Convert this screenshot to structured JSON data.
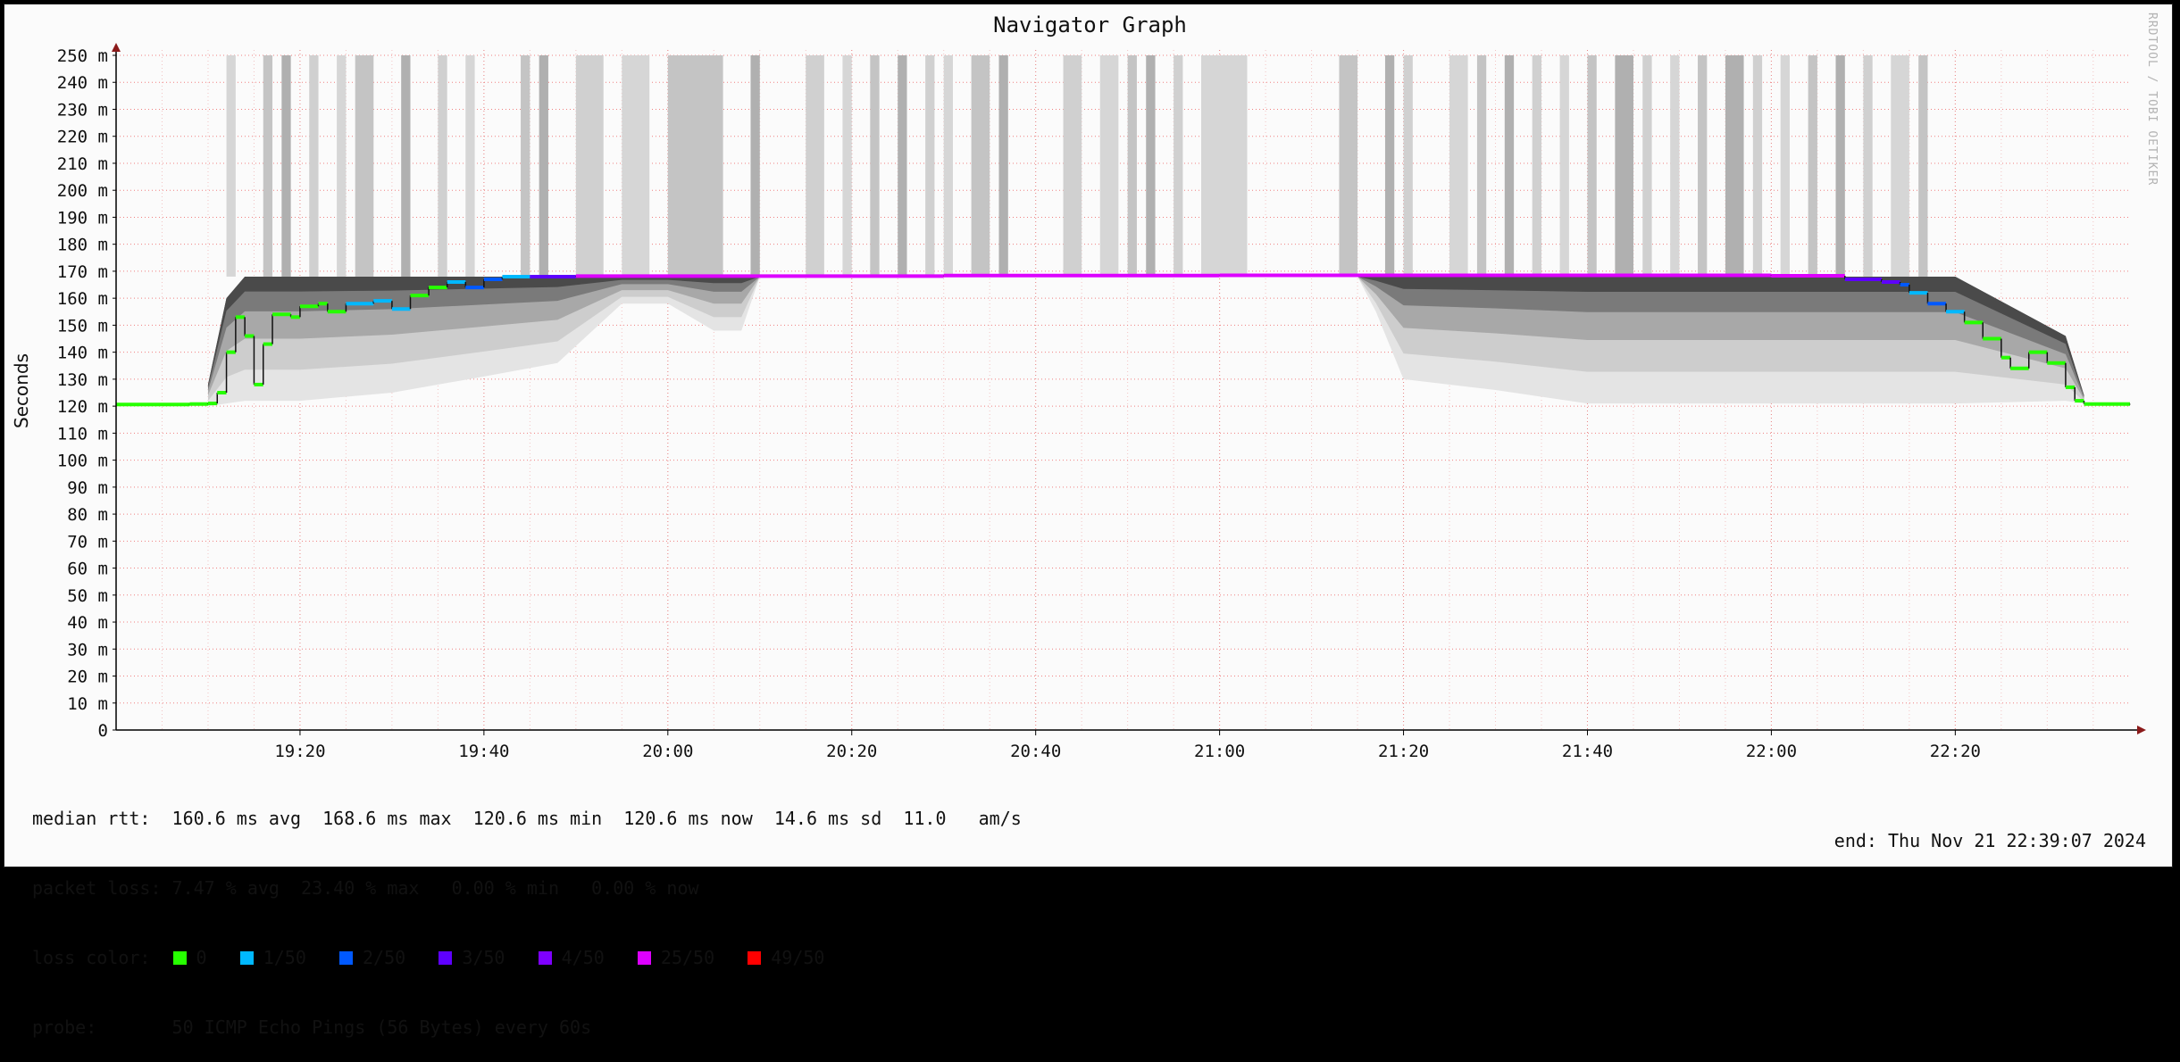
{
  "chart_data": {
    "type": "line",
    "title": "Navigator Graph",
    "ylabel": "Seconds",
    "credit": "RRDTOOL / TOBI OETIKER",
    "ylim": [
      0,
      0.25
    ],
    "y_ticks": [
      {
        "v": 0,
        "label": "0"
      },
      {
        "v": 0.01,
        "label": "10 m"
      },
      {
        "v": 0.02,
        "label": "20 m"
      },
      {
        "v": 0.03,
        "label": "30 m"
      },
      {
        "v": 0.04,
        "label": "40 m"
      },
      {
        "v": 0.05,
        "label": "50 m"
      },
      {
        "v": 0.06,
        "label": "60 m"
      },
      {
        "v": 0.07,
        "label": "70 m"
      },
      {
        "v": 0.08,
        "label": "80 m"
      },
      {
        "v": 0.09,
        "label": "90 m"
      },
      {
        "v": 0.1,
        "label": "100 m"
      },
      {
        "v": 0.11,
        "label": "110 m"
      },
      {
        "v": 0.12,
        "label": "120 m"
      },
      {
        "v": 0.13,
        "label": "130 m"
      },
      {
        "v": 0.14,
        "label": "140 m"
      },
      {
        "v": 0.15,
        "label": "150 m"
      },
      {
        "v": 0.16,
        "label": "160 m"
      },
      {
        "v": 0.17,
        "label": "170 m"
      },
      {
        "v": 0.18,
        "label": "180 m"
      },
      {
        "v": 0.19,
        "label": "190 m"
      },
      {
        "v": 0.2,
        "label": "200 m"
      },
      {
        "v": 0.21,
        "label": "210 m"
      },
      {
        "v": 0.22,
        "label": "220 m"
      },
      {
        "v": 0.23,
        "label": "230 m"
      },
      {
        "v": 0.24,
        "label": "240 m"
      },
      {
        "v": 0.25,
        "label": "250 m"
      }
    ],
    "xlim": [
      "19:00",
      "22:39"
    ],
    "x_ticks": [
      "19:20",
      "19:40",
      "20:00",
      "20:20",
      "20:40",
      "21:00",
      "21:20",
      "21:40",
      "22:00",
      "22:20"
    ],
    "grid": true,
    "median_rtt_series": [
      {
        "t": "19:00",
        "rtt_ms": 120.6,
        "loss": "0"
      },
      {
        "t": "19:08",
        "rtt_ms": 120.8,
        "loss": "0"
      },
      {
        "t": "19:10",
        "rtt_ms": 121.0,
        "loss": "0"
      },
      {
        "t": "19:11",
        "rtt_ms": 125.0,
        "loss": "0"
      },
      {
        "t": "19:12",
        "rtt_ms": 140.0,
        "loss": "0"
      },
      {
        "t": "19:13",
        "rtt_ms": 153.0,
        "loss": "0"
      },
      {
        "t": "19:14",
        "rtt_ms": 146.0,
        "loss": "0"
      },
      {
        "t": "19:15",
        "rtt_ms": 128.0,
        "loss": "0"
      },
      {
        "t": "19:16",
        "rtt_ms": 143.0,
        "loss": "0"
      },
      {
        "t": "19:17",
        "rtt_ms": 154.0,
        "loss": "0"
      },
      {
        "t": "19:19",
        "rtt_ms": 153.0,
        "loss": "0"
      },
      {
        "t": "19:20",
        "rtt_ms": 157.0,
        "loss": "0"
      },
      {
        "t": "19:22",
        "rtt_ms": 158.0,
        "loss": "0"
      },
      {
        "t": "19:23",
        "rtt_ms": 155.0,
        "loss": "0"
      },
      {
        "t": "19:25",
        "rtt_ms": 158.0,
        "loss": "1/50"
      },
      {
        "t": "19:28",
        "rtt_ms": 159.0,
        "loss": "1/50"
      },
      {
        "t": "19:30",
        "rtt_ms": 156.0,
        "loss": "1/50"
      },
      {
        "t": "19:32",
        "rtt_ms": 161.0,
        "loss": "0"
      },
      {
        "t": "19:34",
        "rtt_ms": 164.0,
        "loss": "0"
      },
      {
        "t": "19:36",
        "rtt_ms": 166.0,
        "loss": "1/50"
      },
      {
        "t": "19:38",
        "rtt_ms": 164.0,
        "loss": "2/50"
      },
      {
        "t": "19:40",
        "rtt_ms": 167.0,
        "loss": "2/50"
      },
      {
        "t": "19:42",
        "rtt_ms": 168.0,
        "loss": "1/50"
      },
      {
        "t": "19:45",
        "rtt_ms": 168.0,
        "loss": "3/50"
      },
      {
        "t": "19:50",
        "rtt_ms": 168.2,
        "loss": "25/50"
      },
      {
        "t": "20:30",
        "rtt_ms": 168.4,
        "loss": "25/50"
      },
      {
        "t": "21:00",
        "rtt_ms": 168.5,
        "loss": "25/50"
      },
      {
        "t": "21:30",
        "rtt_ms": 168.5,
        "loss": "25/50"
      },
      {
        "t": "22:00",
        "rtt_ms": 168.3,
        "loss": "25/50"
      },
      {
        "t": "22:08",
        "rtt_ms": 167.0,
        "loss": "3/50"
      },
      {
        "t": "22:12",
        "rtt_ms": 166.0,
        "loss": "3/50"
      },
      {
        "t": "22:14",
        "rtt_ms": 165.0,
        "loss": "2/50"
      },
      {
        "t": "22:15",
        "rtt_ms": 162.0,
        "loss": "1/50"
      },
      {
        "t": "22:17",
        "rtt_ms": 158.0,
        "loss": "2/50"
      },
      {
        "t": "22:19",
        "rtt_ms": 155.0,
        "loss": "1/50"
      },
      {
        "t": "22:21",
        "rtt_ms": 151.0,
        "loss": "0"
      },
      {
        "t": "22:23",
        "rtt_ms": 145.0,
        "loss": "0"
      },
      {
        "t": "22:25",
        "rtt_ms": 138.0,
        "loss": "0"
      },
      {
        "t": "22:26",
        "rtt_ms": 134.0,
        "loss": "0"
      },
      {
        "t": "22:28",
        "rtt_ms": 140.0,
        "loss": "0"
      },
      {
        "t": "22:30",
        "rtt_ms": 136.0,
        "loss": "0"
      },
      {
        "t": "22:32",
        "rtt_ms": 127.0,
        "loss": "0"
      },
      {
        "t": "22:33",
        "rtt_ms": 122.0,
        "loss": "0"
      },
      {
        "t": "22:34",
        "rtt_ms": 120.8,
        "loss": "0"
      },
      {
        "t": "22:39",
        "rtt_ms": 120.6,
        "loss": "0"
      }
    ],
    "smoke_spread": [
      {
        "t": "19:10",
        "min_ms": 120,
        "max_ms": 128
      },
      {
        "t": "19:12",
        "min_ms": 121,
        "max_ms": 160
      },
      {
        "t": "19:14",
        "min_ms": 122,
        "max_ms": 168
      },
      {
        "t": "19:20",
        "min_ms": 122,
        "max_ms": 168
      },
      {
        "t": "19:30",
        "min_ms": 125,
        "max_ms": 168
      },
      {
        "t": "19:40",
        "min_ms": 131,
        "max_ms": 168
      },
      {
        "t": "19:48",
        "min_ms": 136,
        "max_ms": 168
      },
      {
        "t": "19:55",
        "min_ms": 158,
        "max_ms": 168
      },
      {
        "t": "20:00",
        "min_ms": 158,
        "max_ms": 168
      },
      {
        "t": "20:05",
        "min_ms": 148,
        "max_ms": 168
      },
      {
        "t": "20:08",
        "min_ms": 148,
        "max_ms": 168
      },
      {
        "t": "20:10",
        "min_ms": 168,
        "max_ms": 168
      },
      {
        "t": "21:15",
        "min_ms": 168,
        "max_ms": 168
      },
      {
        "t": "21:17",
        "min_ms": 155,
        "max_ms": 168
      },
      {
        "t": "21:20",
        "min_ms": 130,
        "max_ms": 168
      },
      {
        "t": "21:30",
        "min_ms": 126,
        "max_ms": 168
      },
      {
        "t": "21:40",
        "min_ms": 121,
        "max_ms": 168
      },
      {
        "t": "22:00",
        "min_ms": 121,
        "max_ms": 168
      },
      {
        "t": "22:20",
        "min_ms": 121,
        "max_ms": 168
      },
      {
        "t": "22:32",
        "min_ms": 122,
        "max_ms": 146
      },
      {
        "t": "22:34",
        "min_ms": 121,
        "max_ms": 124
      }
    ],
    "loss_bars": [
      [
        "19:12",
        "19:13"
      ],
      [
        "19:16",
        "19:17"
      ],
      [
        "19:18",
        "19:19"
      ],
      [
        "19:21",
        "19:22"
      ],
      [
        "19:24",
        "19:25"
      ],
      [
        "19:26",
        "19:28"
      ],
      [
        "19:31",
        "19:32"
      ],
      [
        "19:35",
        "19:36"
      ],
      [
        "19:38",
        "19:39"
      ],
      [
        "19:44",
        "19:45"
      ],
      [
        "19:46",
        "19:47"
      ],
      [
        "19:50",
        "19:53"
      ],
      [
        "19:55",
        "19:58"
      ],
      [
        "20:00",
        "20:06"
      ],
      [
        "20:09",
        "20:10"
      ],
      [
        "20:15",
        "20:17"
      ],
      [
        "20:19",
        "20:20"
      ],
      [
        "20:22",
        "20:23"
      ],
      [
        "20:25",
        "20:26"
      ],
      [
        "20:28",
        "20:29"
      ],
      [
        "20:30",
        "20:31"
      ],
      [
        "20:33",
        "20:35"
      ],
      [
        "20:36",
        "20:37"
      ],
      [
        "20:43",
        "20:45"
      ],
      [
        "20:47",
        "20:49"
      ],
      [
        "20:50",
        "20:51"
      ],
      [
        "20:52",
        "20:53"
      ],
      [
        "20:55",
        "20:56"
      ],
      [
        "20:58",
        "21:03"
      ],
      [
        "21:13",
        "21:15"
      ],
      [
        "21:18",
        "21:19"
      ],
      [
        "21:20",
        "21:21"
      ],
      [
        "21:25",
        "21:27"
      ],
      [
        "21:28",
        "21:29"
      ],
      [
        "21:31",
        "21:32"
      ],
      [
        "21:34",
        "21:35"
      ],
      [
        "21:37",
        "21:38"
      ],
      [
        "21:40",
        "21:41"
      ],
      [
        "21:43",
        "21:45"
      ],
      [
        "21:46",
        "21:47"
      ],
      [
        "21:49",
        "21:50"
      ],
      [
        "21:52",
        "21:53"
      ],
      [
        "21:55",
        "21:57"
      ],
      [
        "21:58",
        "21:59"
      ],
      [
        "22:01",
        "22:02"
      ],
      [
        "22:04",
        "22:05"
      ],
      [
        "22:07",
        "22:08"
      ],
      [
        "22:10",
        "22:11"
      ],
      [
        "22:13",
        "22:15"
      ],
      [
        "22:16",
        "22:17"
      ]
    ],
    "loss_bar_top_ms": 250,
    "loss_bar_bottom_ms": 168
  },
  "stats": {
    "median_rtt": "median rtt:  160.6 ms avg  168.6 ms max  120.6 ms min  120.6 ms now  14.6 ms sd  11.0   am/s",
    "packet_loss": "packet loss: 7.47 % avg  23.40 % max   0.00 % min   0.00 % now",
    "loss_label": "loss color:",
    "probe": "probe:       50 ICMP Echo Pings (56 Bytes) every 60s",
    "end": "end: Thu Nov 21 22:39:07 2024"
  },
  "legend": [
    {
      "label": "0",
      "color": "#26ff00"
    },
    {
      "label": "1/50",
      "color": "#00b8ff"
    },
    {
      "label": "2/50",
      "color": "#0059ff"
    },
    {
      "label": "3/50",
      "color": "#5e00ff"
    },
    {
      "label": "4/50",
      "color": "#7e00ff"
    },
    {
      "label": "25/50",
      "color": "#dd00ff"
    },
    {
      "label": "49/50",
      "color": "#ff0000"
    }
  ]
}
